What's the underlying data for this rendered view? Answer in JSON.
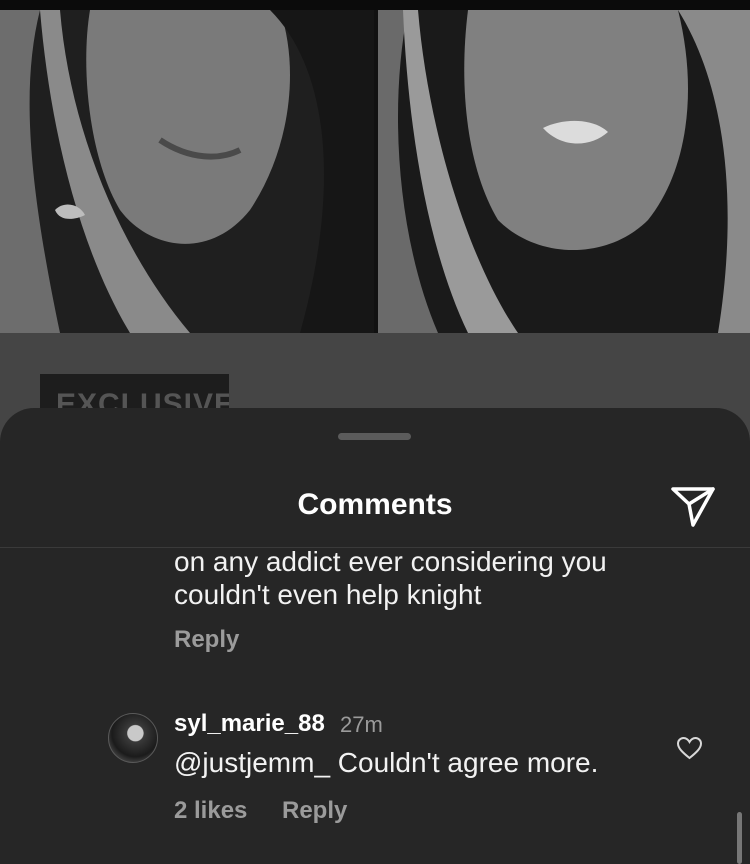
{
  "background_post": {
    "badge_label": "EXCLUSIVE"
  },
  "comments_sheet": {
    "title": "Comments",
    "send_icon": "paper-plane-icon",
    "comments": [
      {
        "text": "on any addict ever considering you couldn't even help knight",
        "reply_label": "Reply"
      },
      {
        "username": "syl_marie_88",
        "time": "27m",
        "text": "@justjemm_ Couldn't agree more.",
        "likes_label": "2 likes",
        "reply_label": "Reply",
        "like_icon": "heart-outline-icon"
      }
    ]
  },
  "colors": {
    "sheet_background": "#262626",
    "muted_text": "#9b9b9b",
    "primary_text": "#ffffff"
  }
}
